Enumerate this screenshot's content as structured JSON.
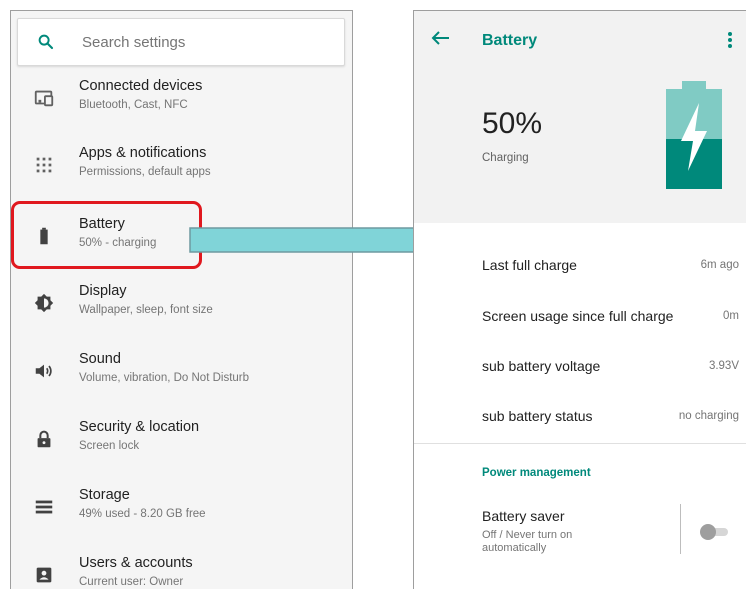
{
  "settings_screen": {
    "search": {
      "placeholder": "Search settings",
      "icon": "search-icon"
    },
    "items": [
      {
        "title": "Connected devices",
        "subtitle": "Bluetooth, Cast, NFC",
        "icon": "devices-icon"
      },
      {
        "title": "Apps & notifications",
        "subtitle": "Permissions, default apps",
        "icon": "apps-grid-icon"
      },
      {
        "title": "Battery",
        "subtitle": "50% - charging",
        "icon": "battery-icon"
      },
      {
        "title": "Display",
        "subtitle": "Wallpaper, sleep, font size",
        "icon": "brightness-icon"
      },
      {
        "title": "Sound",
        "subtitle": "Volume, vibration, Do Not Disturb",
        "icon": "volume-icon"
      },
      {
        "title": "Security & location",
        "subtitle": "Screen lock",
        "icon": "lock-icon"
      },
      {
        "title": "Storage",
        "subtitle": "49% used - 8.20 GB free",
        "icon": "storage-icon"
      },
      {
        "title": "Users & accounts",
        "subtitle": "Current user: Owner",
        "icon": "account-icon"
      }
    ]
  },
  "battery_screen": {
    "title": "Battery",
    "level": "50%",
    "status": "Charging",
    "battery_fill_fraction": 0.5,
    "rows": [
      {
        "label": "Last full charge",
        "value": "6m ago"
      },
      {
        "label": "Screen usage since full charge",
        "value": "0m"
      },
      {
        "label": "sub battery voltage",
        "value": "3.93V"
      },
      {
        "label": "sub battery status",
        "value": "no charging"
      }
    ],
    "section": "Power management",
    "saver": {
      "title": "Battery saver",
      "subtitle": "Off / Never turn on automatically",
      "enabled": false
    }
  },
  "colors": {
    "accent": "#00897b",
    "battery_fill": "#00897b",
    "battery_empty": "#80cbc4",
    "highlight": "#e0181e",
    "arrow_fill": "#80d4d8",
    "arrow_stroke": "#6e9aa0"
  }
}
